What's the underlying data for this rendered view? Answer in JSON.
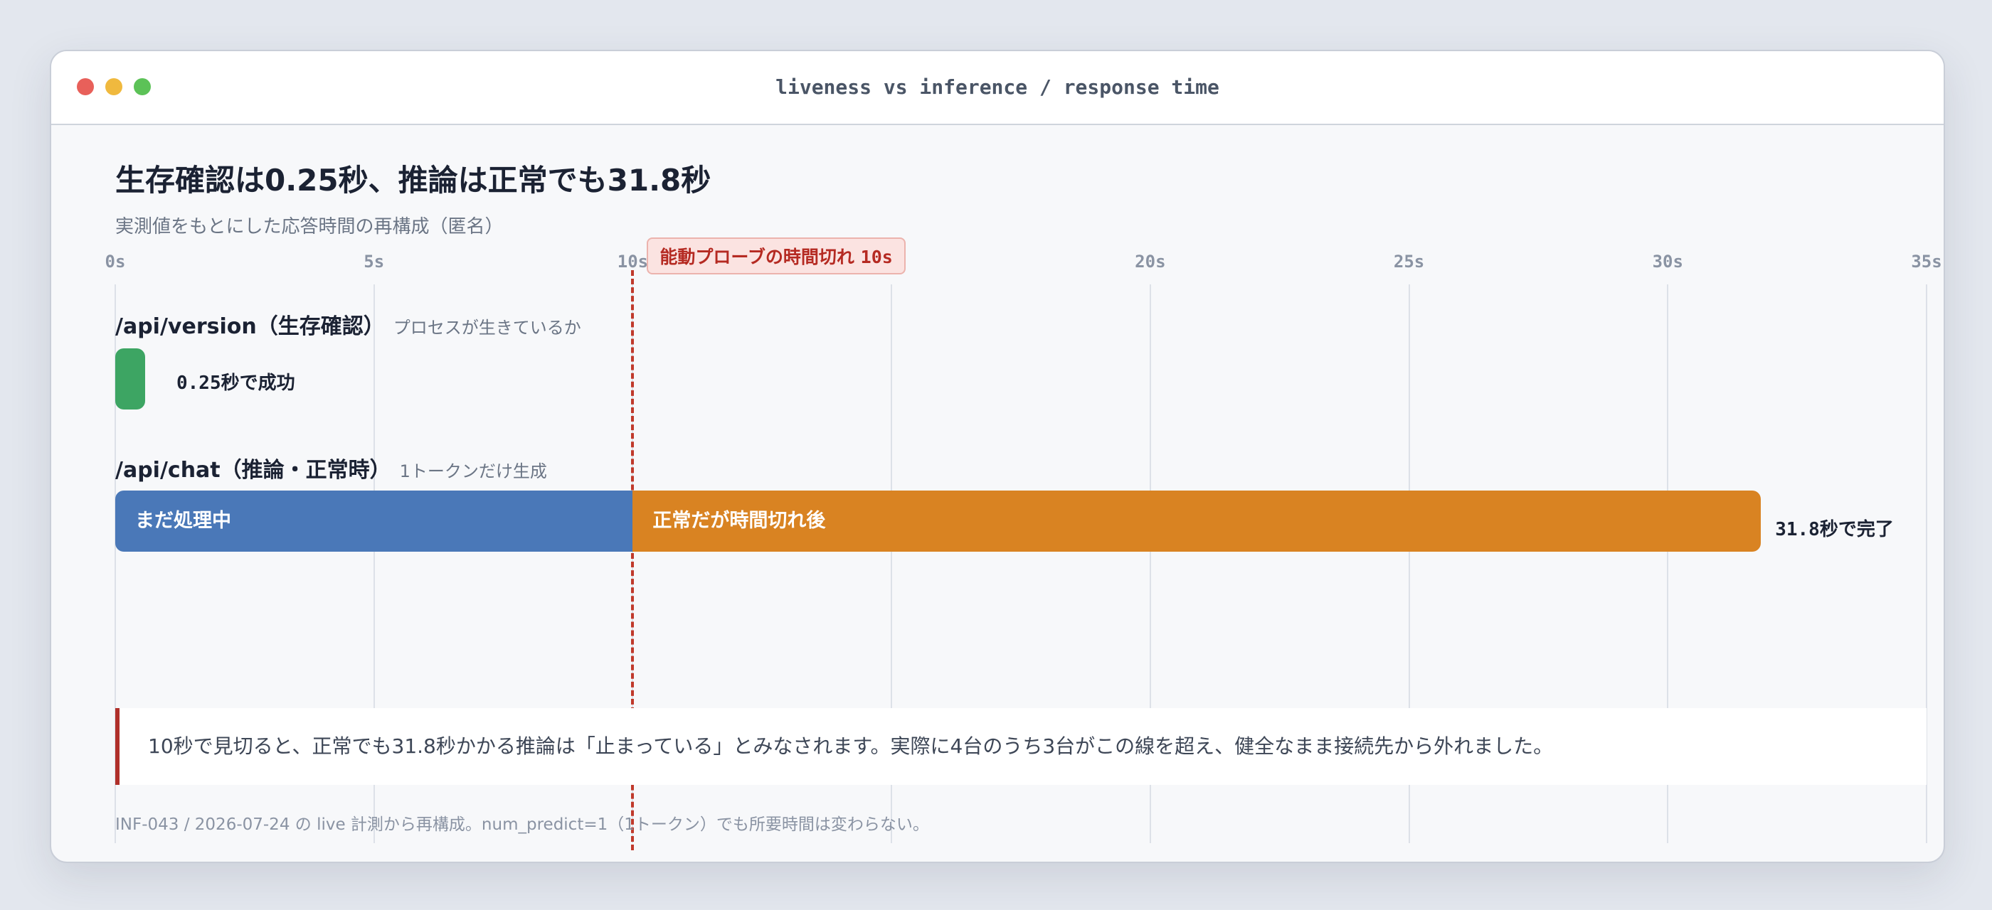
{
  "window": {
    "title": "liveness vs inference / response time"
  },
  "headline": "生存確認は0.25秒、推論は正常でも31.8秒",
  "subtitle": "実測値をもとにした応答時間の再構成（匿名）",
  "threshold": {
    "label": "能動プローブの時間切れ",
    "value_label": "10s"
  },
  "rows": [
    {
      "title": "/api/version（生存確認）",
      "note": "プロセスが生きているか",
      "end_label": "0.25秒で成功"
    },
    {
      "title": "/api/chat（推論・正常時）",
      "note": "1トークンだけ生成",
      "end_label": "31.8秒で完了",
      "segment_labels": [
        "まだ処理中",
        "正常だが時間切れ後"
      ]
    }
  ],
  "callout": "10秒で見切ると、正常でも31.8秒かかる推論は「止まっている」とみなされます。実際に4台のうち3台がこの線を超え、健全なまま接続先から外れました。",
  "footnote": "INF-043 / 2026-07-24 の live 計測から再構成。num_predict=1（1トークン）でも所要時間は変わらない。",
  "chart_data": {
    "type": "bar",
    "orientation": "horizontal",
    "xunit": "s",
    "xlim": [
      0,
      35
    ],
    "ticks": [
      0,
      5,
      10,
      15,
      20,
      25,
      30,
      35
    ],
    "tick_labels": [
      "0s",
      "5s",
      "10s",
      "",
      "20s",
      "25s",
      "30s",
      "35s"
    ],
    "threshold": 10,
    "grid": true,
    "categories": [
      "/api/version（生存確認）",
      "/api/chat（推論・正常時）"
    ],
    "series": [
      {
        "name": "",
        "values": [
          0.25,
          10
        ]
      },
      {
        "name": "",
        "values": [
          0,
          21.8
        ]
      }
    ],
    "totals": [
      0.25,
      31.8
    ]
  },
  "colors": {
    "liveness_bar": "#3da563",
    "before_threshold": "#4a78b8",
    "after_threshold": "#d98322",
    "threshold": "#c0392b"
  }
}
